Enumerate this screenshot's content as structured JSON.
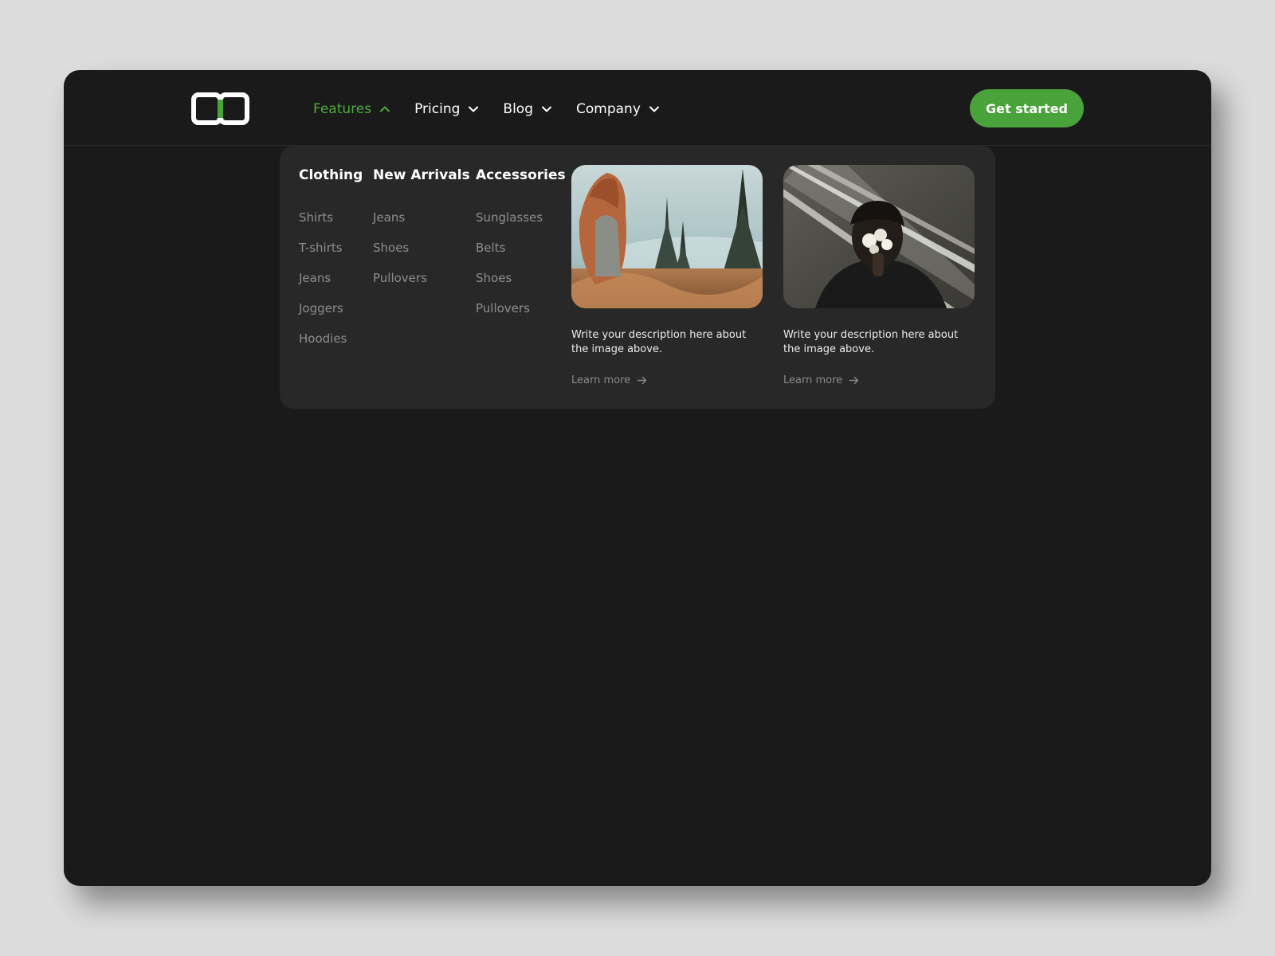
{
  "header": {
    "logo_icon": "logo-mark-icon",
    "nav": [
      {
        "label": "Features",
        "icon": "chevron-up-icon",
        "active": true
      },
      {
        "label": "Pricing",
        "icon": "chevron-down-icon"
      },
      {
        "label": "Blog",
        "icon": "chevron-down-icon"
      },
      {
        "label": "Company",
        "icon": "chevron-down-icon"
      }
    ],
    "cta_label": "Get started"
  },
  "dropdown": {
    "columns": [
      {
        "title": "Clothing",
        "items": [
          "Shirts",
          "T-shirts",
          "Jeans",
          "Joggers",
          "Hoodies"
        ]
      },
      {
        "title": "New Arrivals",
        "items": [
          "Jeans",
          "Shoes",
          "Pullovers"
        ]
      },
      {
        "title": "Accessories",
        "items": [
          "Sunglasses",
          "Belts",
          "Shoes",
          "Pullovers"
        ]
      }
    ],
    "cards": [
      {
        "description": "Write your description here about the image above.",
        "link": "Learn more",
        "link_icon": "arrow-right-icon"
      },
      {
        "description": "Write your description here about the image above.",
        "link": "Learn more",
        "link_icon": "arrow-right-icon"
      }
    ]
  },
  "colors": {
    "accent": "#4aa33a",
    "background": "#1a1a1a",
    "panel": "#282828",
    "muted_text": "#8d8d8d"
  }
}
